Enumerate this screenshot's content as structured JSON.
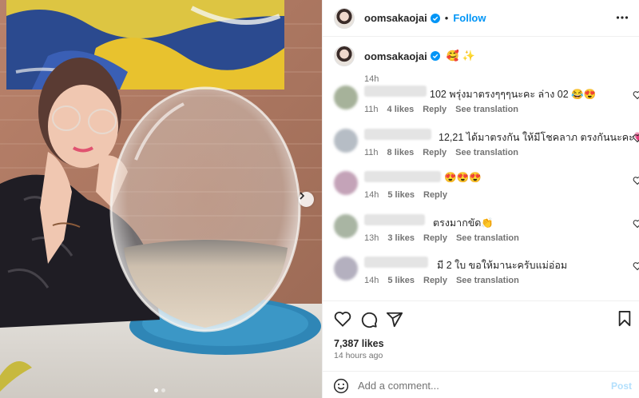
{
  "post": {
    "author": "oomsakaojai",
    "follow_label": "Follow",
    "separator": "•",
    "caption_emojis": "🥰 ✨",
    "caption_time": "14h",
    "likes": "7,387 likes",
    "posted_ago": "14 hours ago",
    "carousel": {
      "slides": 2,
      "current": 1
    }
  },
  "comments": [
    {
      "text": "102 พรุ่งมาตรงๆๆๆนะคะ ล่าง 02 😂😍",
      "time": "11h",
      "likes": "4 likes",
      "reply": "Reply",
      "translate": "See translation"
    },
    {
      "text": "12,21 ได้มาตรงกัน ให้มีโชคลาภ ตรงกันนะคะ💗",
      "time": "11h",
      "likes": "8 likes",
      "reply": "Reply",
      "translate": "See translation"
    },
    {
      "text": "😍😍😍",
      "time": "14h",
      "likes": "5 likes",
      "reply": "Reply",
      "translate": ""
    },
    {
      "text": "ตรงมากขัด👏",
      "time": "13h",
      "likes": "3 likes",
      "reply": "Reply",
      "translate": "See translation"
    },
    {
      "text": "มี 2 ใบ ขอให้มานะครับแม่อ่อม",
      "time": "14h",
      "likes": "5 likes",
      "reply": "Reply",
      "translate": "See translation"
    }
  ],
  "composer": {
    "placeholder": "Add a comment...",
    "post_label": "Post"
  },
  "colors": {
    "accent": "#0095f6",
    "verified": "#0095f6",
    "muted_text": "#737373",
    "post_disabled": "#b2dffc"
  },
  "icons": [
    "verified-badge-icon",
    "more-options-icon",
    "heart-icon",
    "comment-icon",
    "share-icon",
    "bookmark-icon",
    "emoji-icon",
    "chevron-right-icon"
  ]
}
